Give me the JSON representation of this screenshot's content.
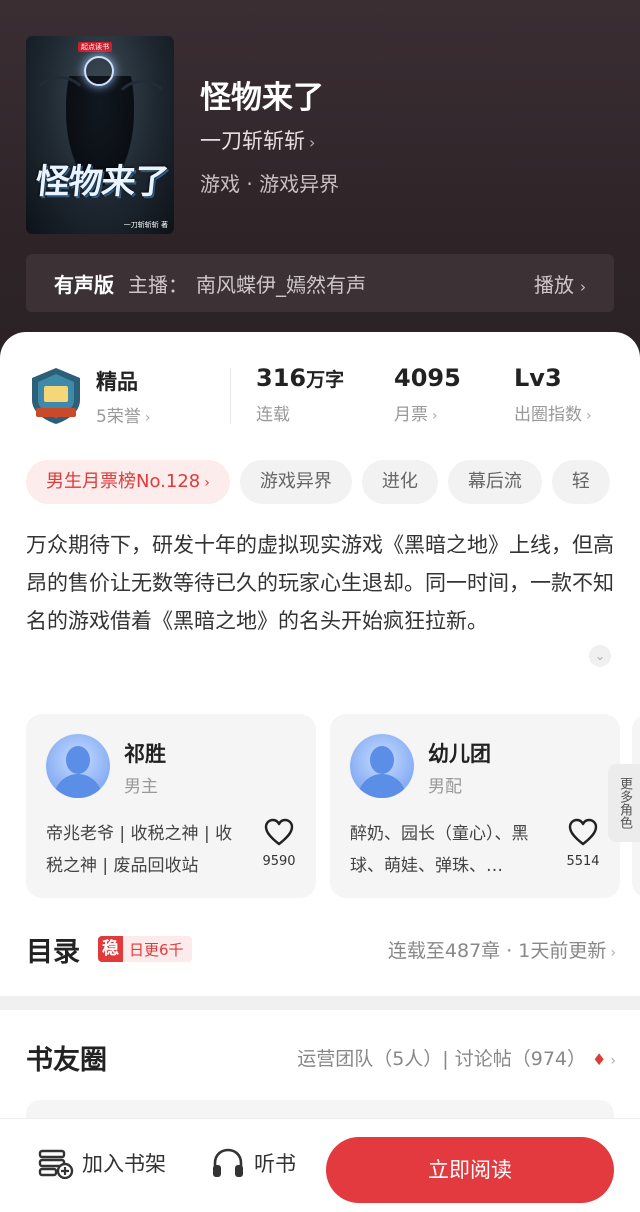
{
  "book": {
    "cover": {
      "badge_text": "起点读书",
      "title_text": "怪物来了",
      "author_text": "一刀斩斩斩 著"
    },
    "title": "怪物来了",
    "author": "一刀斩斩斩",
    "genre": "游戏 · 游戏异界"
  },
  "audio": {
    "label": "有声版",
    "host_key": "主播：",
    "host_value": "南风蝶伊_嫣然有声",
    "play_label": "播放"
  },
  "stats": {
    "quality": {
      "title": "精品",
      "sub": "5荣誉"
    },
    "words": {
      "value": "316",
      "unit": "万字",
      "sub": "连载"
    },
    "monthly": {
      "value": "4095",
      "sub": "月票"
    },
    "level": {
      "value": "Lv3",
      "sub": "出圈指数"
    }
  },
  "tags": [
    "男生月票榜No.128",
    "游戏异界",
    "进化",
    "幕后流",
    "轻"
  ],
  "synopsis": "万众期待下，研发十年的虚拟现实游戏《黑暗之地》上线，但高昂的售价让无数等待已久的玩家心生退却。同一时间，一款不知名的游戏借着《黑暗之地》的名头开始疯狂拉新。",
  "roles": [
    {
      "name": "祁胜",
      "type": "男主",
      "desc": "帝兆老爷 | 收税之神 | 收税之神 | 废品回收站",
      "likes": "9590"
    },
    {
      "name": "幼儿团",
      "type": "男配",
      "desc": "醉奶、园长（童心）、黑球、萌娃、弹珠、…",
      "likes": "5514"
    }
  ],
  "more_roles_label": "更多角色",
  "toc": {
    "title": "目录",
    "steady_mark": "稳",
    "steady_text": "日更6千",
    "status": "连载至487章 · 1天前更新"
  },
  "circle": {
    "title": "书友圈",
    "info": "运营团队（5人）| 讨论帖（974）"
  },
  "bottom": {
    "shelf": "加入书架",
    "listen": "听书",
    "read": "立即阅读"
  },
  "icons": {
    "chevron": "chevron-right-icon",
    "heart": "heart-icon",
    "flame": "flame-icon"
  },
  "colors": {
    "accent": "#e23a3e",
    "hero_bg": "#2f2529"
  }
}
